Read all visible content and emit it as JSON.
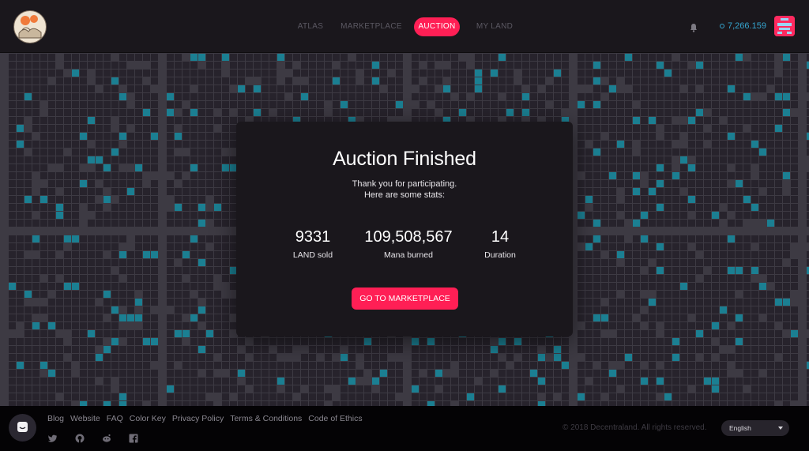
{
  "nav": {
    "items": [
      "ATLAS",
      "MARKETPLACE",
      "AUCTION",
      "MY LAND"
    ],
    "active": "AUCTION"
  },
  "header": {
    "mana_balance": "7,266.159",
    "icons": [
      "logo",
      "bell-icon",
      "mana-icon",
      "avatar"
    ]
  },
  "modal": {
    "title": "Auction Finished",
    "line1": "Thank you for participating.",
    "line2": "Here are some stats:",
    "stats": [
      {
        "value": "9331",
        "label": "LAND sold"
      },
      {
        "value": "109,508,567",
        "label": "Mana burned"
      },
      {
        "value": "14",
        "label": "Duration"
      }
    ],
    "cta_label": "GO TO MARKETPLACE"
  },
  "footer": {
    "links": [
      "Blog",
      "Website",
      "FAQ",
      "Color Key",
      "Privacy Policy",
      "Terms & Conditions",
      "Code of Ethics"
    ],
    "social": [
      "twitter-icon",
      "github-icon",
      "reddit-icon",
      "facebook-icon"
    ],
    "copyright": "© 2018 Decentraland. All rights reserved.",
    "language": "English"
  },
  "colors": {
    "accent": "#ff1f55",
    "mana": "#35a5cf",
    "owned_parcel": "#1b7f92",
    "parcel": "#27232c",
    "road": "#3d3a43"
  }
}
